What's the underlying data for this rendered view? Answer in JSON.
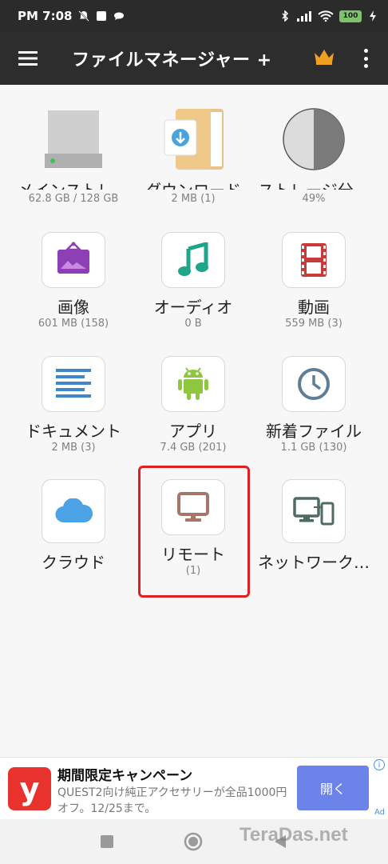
{
  "status_bar": {
    "time": "PM 7:08",
    "battery": "100"
  },
  "app_bar": {
    "title": "ファイルマネージャー +"
  },
  "tiles": [
    {
      "label": "メインストレ…",
      "sub": "62.8 GB / 128 GB",
      "icon": "hard-drive-icon"
    },
    {
      "label": "ダウンロード",
      "sub": "2 MB (1)",
      "icon": "download-folder-icon"
    },
    {
      "label": "ストレージ分…",
      "sub": "49%",
      "icon": "storage-pie-icon",
      "usage_fraction": 0.49
    },
    {
      "label": "画像",
      "sub": "601 MB (158)",
      "icon": "image-icon"
    },
    {
      "label": "オーディオ",
      "sub": "0 B",
      "icon": "music-note-icon"
    },
    {
      "label": "動画",
      "sub": "559 MB (3)",
      "icon": "film-icon"
    },
    {
      "label": "ドキュメント",
      "sub": "2 MB (3)",
      "icon": "document-icon"
    },
    {
      "label": "アプリ",
      "sub": "7.4 GB (201)",
      "icon": "android-icon"
    },
    {
      "label": "新着ファイル",
      "sub": "1.1 GB (130)",
      "icon": "clock-icon"
    },
    {
      "label": "クラウド",
      "sub": "",
      "icon": "cloud-icon"
    },
    {
      "label": "リモート",
      "sub": "(1)",
      "icon": "monitor-icon"
    },
    {
      "label": "ネットワーク…",
      "sub": "",
      "icon": "network-devices-icon"
    }
  ],
  "ad": {
    "title": "期間限定キャンペーン",
    "desc": "QUEST2向け純正アクセサリーが全品1000円オフ。12/25まで。",
    "button": "開く",
    "logo_letter": "y",
    "tag": "Ad",
    "info": "i"
  },
  "watermark": "TeraDas.net",
  "colors": {
    "app_bar": "#2d2d2d",
    "crown": "#f0a020",
    "highlight": "#e02020",
    "ad_button": "#6c84ea",
    "ad_logo": "#e8322d"
  }
}
